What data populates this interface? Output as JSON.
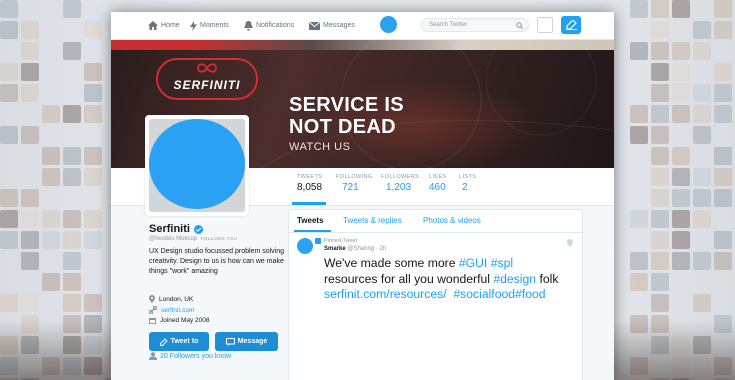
{
  "nav": {
    "home": "Home",
    "moments": "Moments",
    "notifications": "Notifications",
    "messages": "Messages",
    "search_placeholder": "Search Twitter"
  },
  "banner": {
    "logo_text": "SERFINITI",
    "headline_1": "SERVICE IS",
    "headline_2": "NOT DEAD",
    "subline": "WATCH US"
  },
  "stats": [
    {
      "label": "TWEETS",
      "value": "8,058"
    },
    {
      "label": "FOLLOWING",
      "value": "721"
    },
    {
      "label": "FOLLOWERS",
      "value": "1,203"
    },
    {
      "label": "LIKES",
      "value": "460"
    },
    {
      "label": "LISTS",
      "value": "2"
    }
  ],
  "profile": {
    "name": "Serfiniti",
    "handle": "@foodies Mokcup",
    "follows_you": "FOLLOWS YOU",
    "bio": "UX Design studio focussed problem solving creativity. Design to us is how can we make things \"work\" amazing",
    "location": "London, UK",
    "website": "serfinit.com",
    "joined": "Joined May 2008",
    "tweet_to_label": "Tweet to",
    "message_label": "Message",
    "followers_you_know": "20 Followers you know"
  },
  "timeline": {
    "tabs": [
      "Tweets",
      "Tweets & replies",
      "Photos & videos"
    ],
    "pinned_label": "Pinned Tweet",
    "author": "Smarke",
    "author_handle": "@Sharing",
    "time": "· 2h",
    "text_1": "We've made some more ",
    "tag_gui": "#GUI",
    "tag_spl": " #spl",
    "text_2": "resources for all you wonderful ",
    "tag_design": "#design",
    "text_3": " folk",
    "link": "serfinit.com/resources/",
    "tag_social": "  #socialfood",
    "tag_food": "#food"
  },
  "colors": {
    "accent": "#1da1f2",
    "avatar": "#2aa1f2",
    "brand_red": "#d22f2f"
  }
}
